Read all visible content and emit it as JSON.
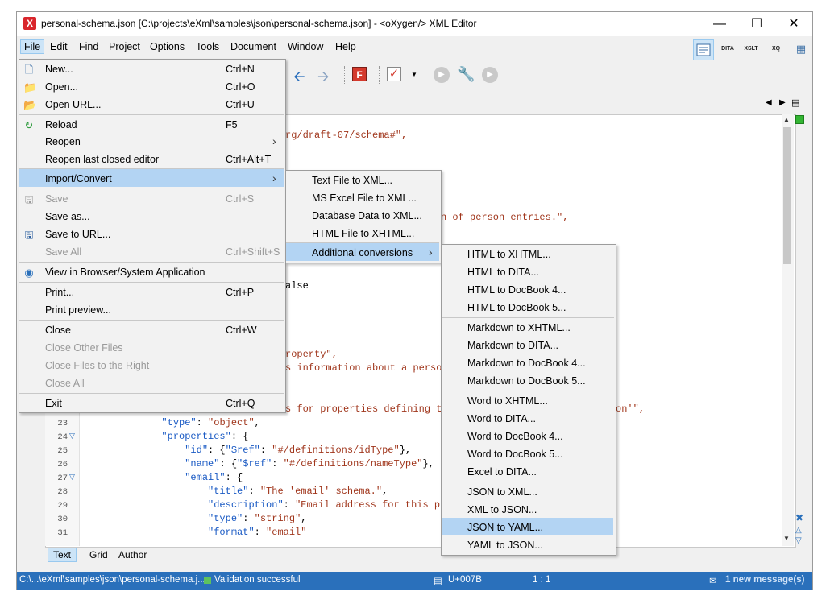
{
  "window": {
    "title": "personal-schema.json [C:\\projects\\eXml\\samples\\json\\personal-schema.json] - <oXygen/> XML Editor",
    "app_icon": "oxygen-icon",
    "controls": [
      "—",
      "☐",
      "✕"
    ]
  },
  "menubar": [
    "File",
    "Edit",
    "Find",
    "Project",
    "Options",
    "Tools",
    "Document",
    "Window",
    "Help"
  ],
  "file_menu": {
    "items": [
      {
        "label": "New...",
        "shortcut": "Ctrl+N",
        "icon": "new-file-icon"
      },
      {
        "label": "Open...",
        "shortcut": "Ctrl+O",
        "icon": "folder-icon"
      },
      {
        "label": "Open URL...",
        "shortcut": "Ctrl+U",
        "icon": "folder-url-icon"
      },
      {
        "label": "Reload",
        "shortcut": "F5",
        "icon": "reload-icon"
      },
      {
        "label": "Reopen",
        "shortcut": "",
        "submenu": true
      },
      {
        "label": "Reopen last closed editor",
        "shortcut": "Ctrl+Alt+T"
      },
      {
        "label": "Import/Convert",
        "shortcut": "",
        "submenu": true,
        "highlighted": true
      },
      {
        "label": "Save",
        "shortcut": "Ctrl+S",
        "disabled": true,
        "icon": "save-icon"
      },
      {
        "label": "Save as...",
        "shortcut": ""
      },
      {
        "label": "Save to URL...",
        "shortcut": "",
        "icon": "save-url-icon"
      },
      {
        "label": "Save All",
        "shortcut": "Ctrl+Shift+S",
        "disabled": true
      },
      {
        "label": "View in Browser/System Application",
        "shortcut": "",
        "icon": "browser-icon"
      },
      {
        "label": "Print...",
        "shortcut": "Ctrl+P"
      },
      {
        "label": "Print preview...",
        "shortcut": ""
      },
      {
        "label": "Close",
        "shortcut": "Ctrl+W"
      },
      {
        "label": "Close Other Files",
        "shortcut": "",
        "disabled": true
      },
      {
        "label": "Close Files to the Right",
        "shortcut": "",
        "disabled": true
      },
      {
        "label": "Close All",
        "shortcut": "",
        "disabled": true
      },
      {
        "label": "Exit",
        "shortcut": "Ctrl+Q"
      }
    ]
  },
  "import_menu": {
    "items": [
      {
        "label": "Text File to XML..."
      },
      {
        "label": "MS Excel File to XML..."
      },
      {
        "label": "Database Data to XML..."
      },
      {
        "label": "HTML File to XHTML..."
      },
      {
        "label": "Additional conversions",
        "submenu": true,
        "highlighted": true
      }
    ]
  },
  "conversions_menu": {
    "items": [
      {
        "label": "HTML to XHTML..."
      },
      {
        "label": "HTML to DITA..."
      },
      {
        "label": "HTML to DocBook 4..."
      },
      {
        "label": "HTML to DocBook 5..."
      },
      {
        "label": "Markdown to XHTML..."
      },
      {
        "label": "Markdown to DITA..."
      },
      {
        "label": "Markdown to DocBook 4..."
      },
      {
        "label": "Markdown to DocBook 5..."
      },
      {
        "label": "Word to XHTML..."
      },
      {
        "label": "Word to DITA..."
      },
      {
        "label": "Word to DocBook 4..."
      },
      {
        "label": "Word to DocBook 5..."
      },
      {
        "label": "Excel to DITA..."
      },
      {
        "label": "JSON to XML..."
      },
      {
        "label": "XML to JSON..."
      },
      {
        "label": "JSON to YAML...",
        "highlighted": true
      },
      {
        "label": "YAML to JSON..."
      }
    ]
  },
  "perspectives": [
    "DITA",
    "XSLT",
    "XQ"
  ],
  "editor": {
    "fragments": [
      {
        "text": "rg/draft-07/schema#\","
      },
      {
        "text": "n of person entries.\","
      },
      {
        "text": "alse"
      },
      {
        "text": "roperty\","
      },
      {
        "text": "s information about a person"
      },
      {
        "text": "s for properties defining th"
      },
      {
        "text": "on'\","
      }
    ],
    "lines": [
      {
        "num": "23",
        "fold": false,
        "parts": [
          {
            "t": "            ",
            "c": ""
          },
          {
            "t": "\"type\"",
            "c": "key"
          },
          {
            "t": ": ",
            "c": ""
          },
          {
            "t": "\"object\"",
            "c": "str"
          },
          {
            "t": ",",
            "c": ""
          }
        ]
      },
      {
        "num": "24",
        "fold": true,
        "parts": [
          {
            "t": "            ",
            "c": ""
          },
          {
            "t": "\"properties\"",
            "c": "key"
          },
          {
            "t": ": {",
            "c": ""
          }
        ]
      },
      {
        "num": "25",
        "fold": false,
        "parts": [
          {
            "t": "                ",
            "c": ""
          },
          {
            "t": "\"id\"",
            "c": "key"
          },
          {
            "t": ": {",
            "c": ""
          },
          {
            "t": "\"$ref\"",
            "c": "key"
          },
          {
            "t": ": ",
            "c": ""
          },
          {
            "t": "\"#/definitions/idType\"",
            "c": "str"
          },
          {
            "t": "},",
            "c": ""
          }
        ]
      },
      {
        "num": "26",
        "fold": false,
        "parts": [
          {
            "t": "                ",
            "c": ""
          },
          {
            "t": "\"name\"",
            "c": "key"
          },
          {
            "t": ": {",
            "c": ""
          },
          {
            "t": "\"$ref\"",
            "c": "key"
          },
          {
            "t": ": ",
            "c": ""
          },
          {
            "t": "\"#/definitions/nameType\"",
            "c": "str"
          },
          {
            "t": "},",
            "c": ""
          }
        ]
      },
      {
        "num": "27",
        "fold": true,
        "parts": [
          {
            "t": "                ",
            "c": ""
          },
          {
            "t": "\"email\"",
            "c": "key"
          },
          {
            "t": ": {",
            "c": ""
          }
        ]
      },
      {
        "num": "28",
        "fold": false,
        "parts": [
          {
            "t": "                    ",
            "c": ""
          },
          {
            "t": "\"title\"",
            "c": "key"
          },
          {
            "t": ": ",
            "c": ""
          },
          {
            "t": "\"The 'email' schema.\"",
            "c": "str"
          },
          {
            "t": ",",
            "c": ""
          }
        ]
      },
      {
        "num": "29",
        "fold": false,
        "parts": [
          {
            "t": "                    ",
            "c": ""
          },
          {
            "t": "\"description\"",
            "c": "key"
          },
          {
            "t": ": ",
            "c": ""
          },
          {
            "t": "\"Email address for this p",
            "c": "str"
          }
        ]
      },
      {
        "num": "30",
        "fold": false,
        "parts": [
          {
            "t": "                    ",
            "c": ""
          },
          {
            "t": "\"type\"",
            "c": "key"
          },
          {
            "t": ": ",
            "c": ""
          },
          {
            "t": "\"string\"",
            "c": "str"
          },
          {
            "t": ",",
            "c": ""
          }
        ]
      },
      {
        "num": "31",
        "fold": false,
        "parts": [
          {
            "t": "                    ",
            "c": ""
          },
          {
            "t": "\"format\"",
            "c": "key"
          },
          {
            "t": ": ",
            "c": ""
          },
          {
            "t": "\"email\"",
            "c": "str"
          }
        ]
      }
    ]
  },
  "editor_tabs": [
    "Text",
    "Grid",
    "Author"
  ],
  "statusbar": {
    "path": "C:\\...\\eXml\\samples\\json\\personal-schema.j...",
    "validation": "Validation successful",
    "char": "U+007B",
    "position": "1 : 1",
    "messages": "1 new message(s)"
  },
  "colors": {
    "statusbar": "#2a70bb",
    "menu_highlight": "#b3d4f3",
    "json_key": "#1a5ac4",
    "json_string": "#a0361c"
  }
}
